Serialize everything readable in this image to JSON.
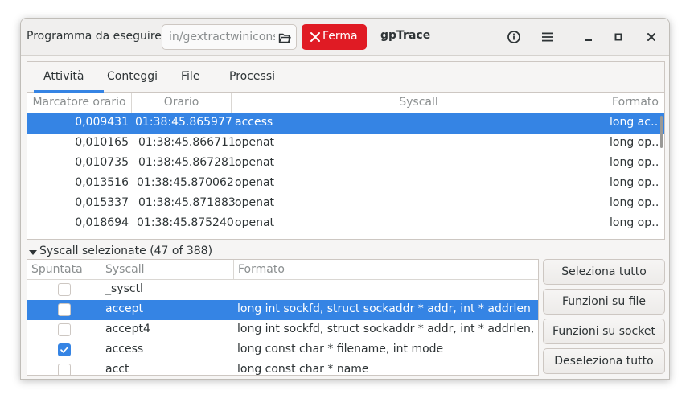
{
  "header": {
    "program_label": "Programma da eseguire:",
    "program_path": "in/gextractwinicons",
    "stop_label": "Ferma",
    "app_title": "gpTrace",
    "icons": [
      "folder-open-icon",
      "close-x-icon",
      "info-icon",
      "hamburger-menu-icon",
      "minimize-icon",
      "maximize-icon",
      "window-close-icon"
    ]
  },
  "tabs": [
    {
      "label": "Attività"
    },
    {
      "label": "Conteggi"
    },
    {
      "label": "File"
    },
    {
      "label": "Processi"
    }
  ],
  "activity_table": {
    "columns": [
      "Marcatore orario",
      "Orario",
      "Syscall",
      "Formato"
    ],
    "rows": [
      {
        "marker": "0,009431",
        "time": "01:38:45.865977",
        "syscall": "access",
        "format": "long ac…"
      },
      {
        "marker": "0,010165",
        "time": "01:38:45.866711",
        "syscall": "openat",
        "format": "long op…"
      },
      {
        "marker": "0,010735",
        "time": "01:38:45.867281",
        "syscall": "openat",
        "format": "long op…"
      },
      {
        "marker": "0,013516",
        "time": "01:38:45.870062",
        "syscall": "openat",
        "format": "long op…"
      },
      {
        "marker": "0,015337",
        "time": "01:38:45.871883",
        "syscall": "openat",
        "format": "long op…"
      },
      {
        "marker": "0,018694",
        "time": "01:38:45.875240",
        "syscall": "openat",
        "format": "long op…"
      }
    ]
  },
  "syscall_section": {
    "expander_label": "Syscall selezionate (47 of 388)",
    "columns": [
      "Spuntata",
      "Syscall",
      "Formato"
    ],
    "rows": [
      {
        "checked": false,
        "name": "_sysctl",
        "format": ""
      },
      {
        "checked": false,
        "name": "accept",
        "format": "long int sockfd, struct sockaddr * addr, int * addrlen"
      },
      {
        "checked": false,
        "name": "accept4",
        "format": "long int sockfd, struct sockaddr * addr, int * addrlen, int fla"
      },
      {
        "checked": true,
        "name": "access",
        "format": "long const char * filename, int mode"
      },
      {
        "checked": false,
        "name": "acct",
        "format": "long const char * name"
      }
    ]
  },
  "buttons": {
    "select_all": "Seleziona tutto",
    "file_functions": "Funzioni su file",
    "socket_functions": "Funzioni su socket",
    "deselect_all": "Deseleziona tutto"
  },
  "colors": {
    "accent": "#3584e4",
    "stop": "#e01b24"
  }
}
